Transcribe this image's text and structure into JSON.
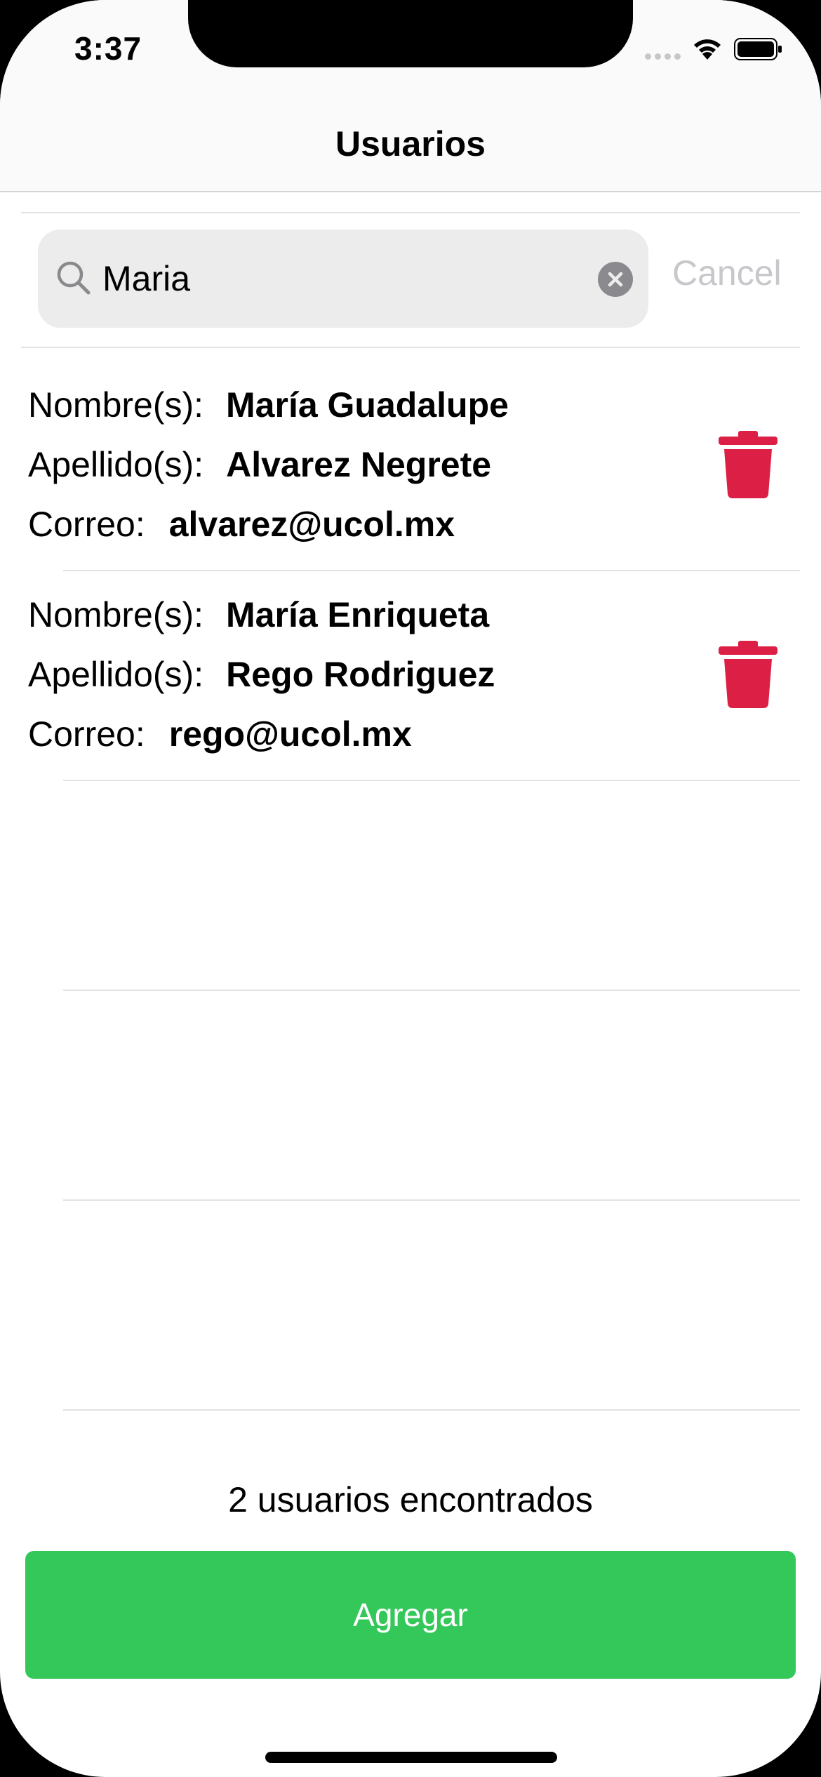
{
  "status_bar": {
    "time": "3:37",
    "signal_icon": "cellular-signal-icon",
    "wifi_icon": "wifi-icon",
    "battery_icon": "battery-icon"
  },
  "nav": {
    "title": "Usuarios"
  },
  "search": {
    "value": "Maria",
    "placeholder": "",
    "cancel_label": "Cancel",
    "search_icon": "search-icon",
    "clear_icon": "clear-circle-icon"
  },
  "labels": {
    "nombre": "Nombre(s):",
    "apellido": "Apellido(s):",
    "correo": "Correo:"
  },
  "users": [
    {
      "nombre": "María Guadalupe",
      "apellido": "Alvarez Negrete",
      "correo": "alvarez@ucol.mx"
    },
    {
      "nombre": "María Enriqueta",
      "apellido": "Rego Rodriguez",
      "correo": "rego@ucol.mx"
    }
  ],
  "footer": {
    "results_text": "2 usuarios encontrados",
    "add_label": "Agregar"
  },
  "colors": {
    "accent_green": "#34c759",
    "delete_red": "#dc1f45",
    "cancel_gray": "#c7c7cc"
  }
}
